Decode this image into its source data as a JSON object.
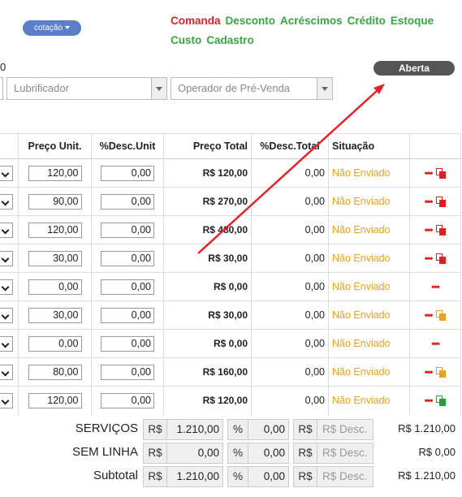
{
  "header": {
    "cotacao_label": "cotação",
    "menu": [
      {
        "label": "Comanda",
        "color": "#e0202a"
      },
      {
        "label": "Desconto",
        "color": "#3aa344"
      },
      {
        "label": "Acréscimos",
        "color": "#3aa344"
      },
      {
        "label": "Crédito",
        "color": "#3aa344"
      },
      {
        "label": "Estoque",
        "color": "#3aa344"
      },
      {
        "label": "Custo",
        "color": "#3aa344"
      },
      {
        "label": "Cadastro",
        "color": "#3aa344"
      }
    ],
    "status_pill": "Aberta",
    "zero_text": "0",
    "lubrificador_placeholder": "Lubrificador",
    "operador_placeholder": "Operador de Pré-Venda"
  },
  "table": {
    "headers": [
      "Preço Unit.",
      "%Desc.Unit",
      "Preço Total",
      "%Desc.Total",
      "Situação"
    ],
    "rows": [
      {
        "unit": "120,00",
        "desc_unit": "0,00",
        "total": "R$ 120,00",
        "desc_total": "0,00",
        "status": "Não Enviado",
        "icon": "red"
      },
      {
        "unit": "90,00",
        "desc_unit": "0,00",
        "total": "R$ 270,00",
        "desc_total": "0,00",
        "status": "Não Enviado",
        "icon": "red"
      },
      {
        "unit": "120,00",
        "desc_unit": "0,00",
        "total": "R$ 480,00",
        "desc_total": "0,00",
        "status": "Não Enviado",
        "icon": "red"
      },
      {
        "unit": "30,00",
        "desc_unit": "0,00",
        "total": "R$ 30,00",
        "desc_total": "0,00",
        "status": "Não Enviado",
        "icon": "red"
      },
      {
        "unit": "0,00",
        "desc_unit": "0,00",
        "total": "R$ 0,00",
        "desc_total": "0,00",
        "status": "Não Enviado",
        "icon": "none"
      },
      {
        "unit": "30,00",
        "desc_unit": "0,00",
        "total": "R$ 30,00",
        "desc_total": "0,00",
        "status": "Não Enviado",
        "icon": "orange"
      },
      {
        "unit": "0,00",
        "desc_unit": "0,00",
        "total": "R$ 0,00",
        "desc_total": "0,00",
        "status": "Não Enviado",
        "icon": "none"
      },
      {
        "unit": "80,00",
        "desc_unit": "0,00",
        "total": "R$ 160,00",
        "desc_total": "0,00",
        "status": "Não Enviado",
        "icon": "orange"
      },
      {
        "unit": "120,00",
        "desc_unit": "0,00",
        "total": "R$ 120,00",
        "desc_total": "0,00",
        "status": "Não Enviado",
        "icon": "green"
      }
    ],
    "actions_glyph": "•••"
  },
  "totals": [
    {
      "label": "SERVIÇOS",
      "currency": "R$",
      "value": "1.210,00",
      "pct": "%",
      "pct_value": "0,00",
      "desc_currency": "R$",
      "desc_placeholder": "R$ Desc.",
      "total": "R$ 1.210,00"
    },
    {
      "label": "SEM LINHA",
      "currency": "R$",
      "value": "0,00",
      "pct": "%",
      "pct_value": "0,00",
      "desc_currency": "R$",
      "desc_placeholder": "R$ Desc.",
      "total": "R$ 0,00"
    },
    {
      "label": "Subtotal",
      "currency": "R$",
      "value": "1.210,00",
      "pct": "%",
      "pct_value": "0,00",
      "desc_currency": "R$",
      "desc_placeholder": "R$ Desc.",
      "total": "R$ 1.210,00"
    }
  ],
  "colors": {
    "status": "#f0a020",
    "red_icon": "#e02020",
    "orange_icon": "#f0a020",
    "green_icon": "#2a9a3a",
    "arrow": "#e8202a"
  }
}
